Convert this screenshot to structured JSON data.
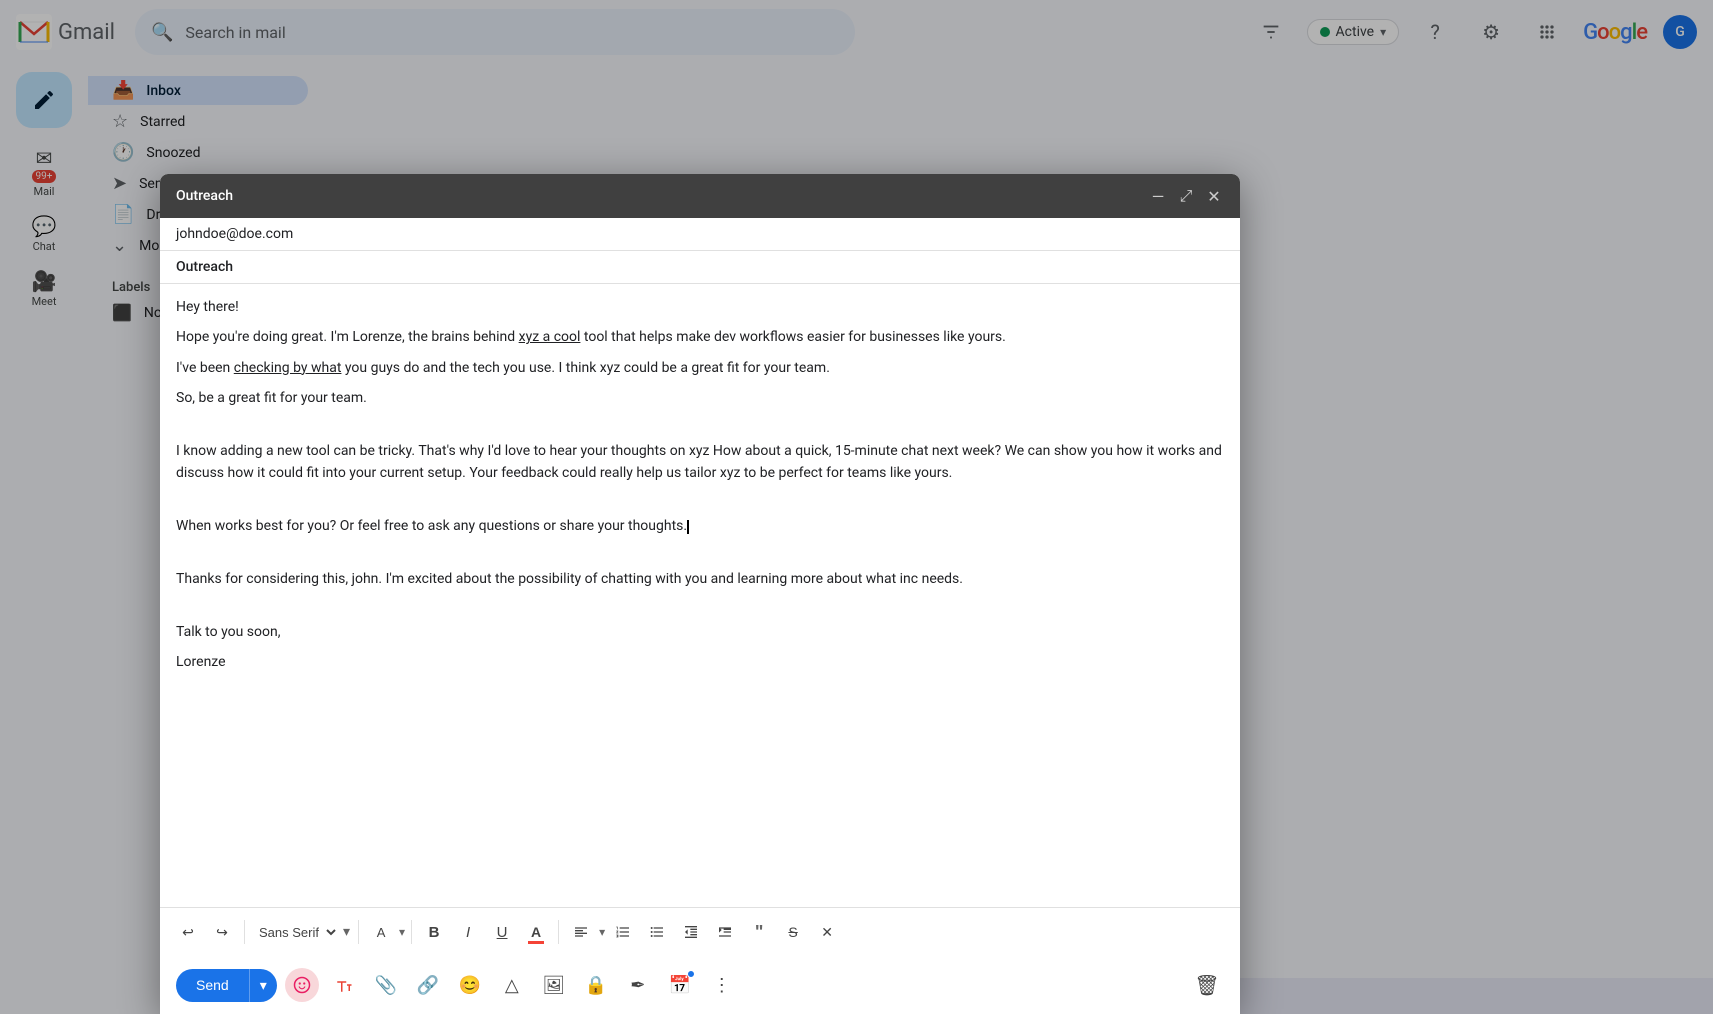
{
  "app": {
    "title": "Gmail",
    "search_placeholder": "Search in mail"
  },
  "topbar": {
    "active_label": "Active",
    "filter_icon": "⊞",
    "help_icon": "?",
    "settings_icon": "⚙",
    "apps_icon": "⠿",
    "avatar_initials": "G"
  },
  "sidebar": {
    "compose_label": "Compose",
    "items": [
      {
        "icon": "✉",
        "label": "Mail",
        "active": false,
        "notif": "99+"
      },
      {
        "icon": "✏",
        "label": "Co",
        "active": true
      },
      {
        "icon": "☰",
        "label": "Inbox",
        "active": false
      },
      {
        "icon": "★",
        "label": "Sta",
        "active": false
      },
      {
        "icon": "🕐",
        "label": "Sn",
        "active": false
      },
      {
        "icon": "➤",
        "label": "Se",
        "active": false
      },
      {
        "icon": "📄",
        "label": "Dr",
        "active": false
      },
      {
        "icon": "⌄",
        "label": "Mo",
        "active": false
      }
    ],
    "labels_title": "Labels",
    "labels": [
      {
        "icon": "⬛",
        "label": "No"
      }
    ],
    "chat_label": "Chat",
    "meet_label": "Meet"
  },
  "compose": {
    "title": "Outreach",
    "to": "johndoe@doe.com",
    "subject": "Outreach",
    "body": {
      "greeting": "Hey there!",
      "p1": "Hope you're doing great. I'm Lorenze, the brains behind xyz a cool tool that helps make dev workflows easier for businesses like yours.",
      "p2": "I've been checking by what you guys do and the tech you use. I think xyz could be a great fit for your team.",
      "p3": "So, be a great fit for your team.",
      "p4": "I know adding a new tool can be tricky. That's why I'd love to hear your thoughts on xyz How about a quick, 15-minute chat next week? We can show you how it works and discuss how it could fit into your current setup. Your feedback could really help us tailor xyz to be perfect for teams like yours.",
      "p5": "When works best for you? Or feel free to ask any questions or share your thoughts.",
      "p6": "Thanks for considering this, john. I'm excited about the possibility of chatting with you and learning more about what inc needs.",
      "closing1": "Talk to you soon,",
      "closing2": "Lorenze"
    },
    "toolbar": {
      "undo": "↩",
      "redo": "↪",
      "font": "Sans Serif",
      "font_size": "A",
      "bold": "B",
      "italic": "I",
      "underline": "U",
      "text_color": "A",
      "align": "≡",
      "ordered_list": "≡",
      "unordered_list": "≡",
      "indent_less": "⇤",
      "indent_more": "⇥",
      "quote": "❝",
      "strikethrough": "S",
      "remove_format": "✕"
    },
    "send_label": "Send",
    "xyz_underlined1": "xyz a cool",
    "checking_underlined": "checking by what"
  }
}
